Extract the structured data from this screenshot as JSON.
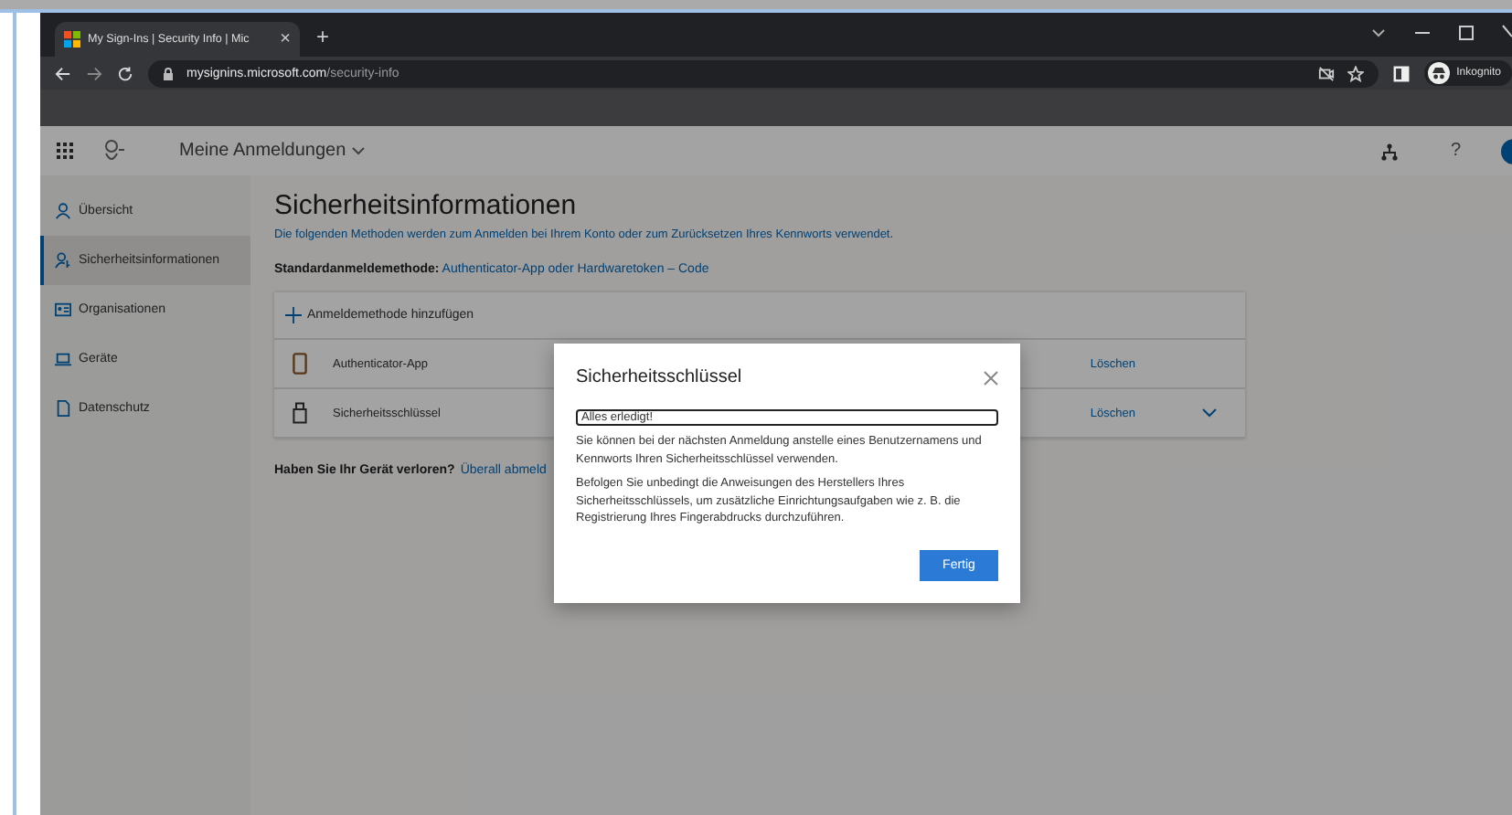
{
  "browser": {
    "tab": {
      "title": "My Sign-Ins | Security Info | Mic",
      "close": "×"
    },
    "new_tab": "+",
    "address_host": "mysignins.microsoft.com",
    "address_path": "/security-info",
    "profile": "Inkognito"
  },
  "header": {
    "title": "Meine Anmeldungen",
    "help": "?"
  },
  "sidebar": {
    "items": [
      {
        "label": "Übersicht",
        "kind": "person",
        "selected": false
      },
      {
        "label": "Sicherheitsinformationen",
        "kind": "security",
        "selected": true
      },
      {
        "label": "Organisationen",
        "kind": "org",
        "selected": false
      },
      {
        "label": "Geräte",
        "kind": "device",
        "selected": false
      },
      {
        "label": "Datenschutz",
        "kind": "privacy",
        "selected": false
      }
    ]
  },
  "main": {
    "title": "Sicherheitsinformationen",
    "description": "Die folgenden Methoden werden zum Anmelden bei Ihrem Konto oder zum Zurücksetzen Ihres Kennworts verwendet.",
    "default_method": "**Standardanmeldemethode:** Authenticator-App oder Hardwaretoken – Code",
    "add_method": "Anmeldemethode hinzufügen",
    "methods": [
      {
        "name": "Authenticator-App",
        "kind": "phone",
        "action": "Löschen",
        "expandable": false
      },
      {
        "name": "Sicherheitsschlüssel",
        "kind": "key",
        "action": "Löschen",
        "expandable": true
      }
    ],
    "lost_device": "Haben Sie Ihr Gerät verloren?",
    "lost_link": "Überall abmeld"
  },
  "dialog": {
    "title": "Sicherheitsschlüssel",
    "field_value": "Alles erledigt!",
    "paragraphs": [
      "Sie können bei der nächsten Anmeldung anstelle eines Benutzernamens und Kennworts Ihren Sicherheitsschlüssel verwenden.",
      "Befolgen Sie unbedingt die Anweisungen des Herstellers Ihres Sicherheitsschlüssels, um zusätzliche Einrichtungsaufgaben wie z. B. die Registrierung Ihres Fingerabdrucks durchzuführen."
    ],
    "button": "Fertig"
  }
}
